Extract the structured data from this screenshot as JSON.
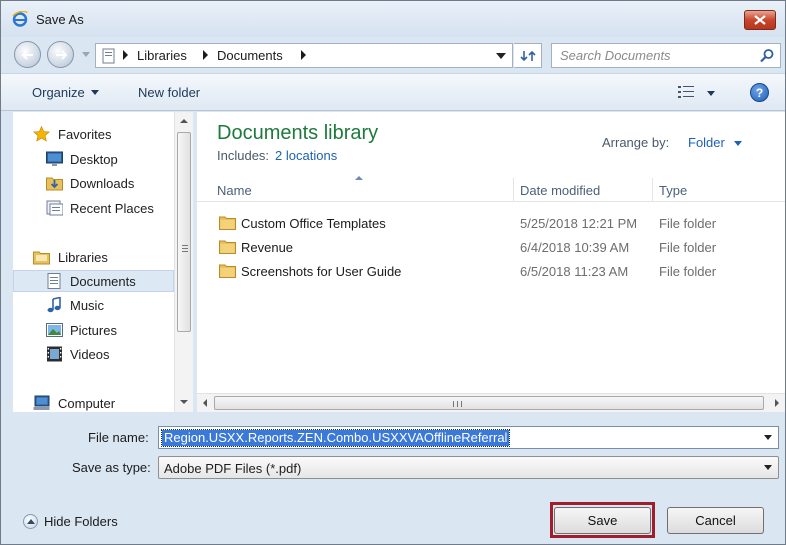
{
  "window": {
    "title": "Save As"
  },
  "address": {
    "crumbs": [
      "Libraries",
      "Documents"
    ],
    "search_placeholder": "Search Documents"
  },
  "toolbar": {
    "organize": "Organize",
    "new_folder": "New folder"
  },
  "nav": {
    "items": [
      {
        "label": "Favorites",
        "icon": "star-icon"
      },
      {
        "label": "Desktop",
        "icon": "desktop-icon"
      },
      {
        "label": "Downloads",
        "icon": "downloads-folder-icon"
      },
      {
        "label": "Recent Places",
        "icon": "recent-places-icon"
      },
      {
        "label": "Libraries",
        "icon": "libraries-icon"
      },
      {
        "label": "Documents",
        "icon": "documents-icon",
        "selected": true
      },
      {
        "label": "Music",
        "icon": "music-icon"
      },
      {
        "label": "Pictures",
        "icon": "pictures-icon"
      },
      {
        "label": "Videos",
        "icon": "videos-icon"
      },
      {
        "label": "Computer",
        "icon": "computer-icon"
      }
    ]
  },
  "library": {
    "title": "Documents library",
    "includes_label": "Includes:",
    "includes_link": "2 locations",
    "arrange_label": "Arrange by:",
    "arrange_value": "Folder"
  },
  "columns": {
    "name": "Name",
    "date": "Date modified",
    "type": "Type"
  },
  "files": [
    {
      "name": "Custom Office Templates",
      "date": "5/25/2018 12:21 PM",
      "type": "File folder"
    },
    {
      "name": "Revenue",
      "date": "6/4/2018 10:39 AM",
      "type": "File folder"
    },
    {
      "name": "Screenshots for User Guide",
      "date": "6/5/2018 11:23 AM",
      "type": "File folder"
    }
  ],
  "form": {
    "file_name_label": "File name:",
    "file_name_value": "Region.USXX.Reports.ZEN.Combo.USXXVAOfflineReferral",
    "save_type_label": "Save as type:",
    "save_type_value": "Adobe PDF Files (*.pdf)"
  },
  "footer": {
    "hide_folders": "Hide Folders",
    "save": "Save",
    "cancel": "Cancel"
  },
  "colors": {
    "library_title": "#1e7a3c",
    "link": "#1f61b3",
    "highlight_border": "#a01d2b",
    "selection": "#3b79d8"
  }
}
